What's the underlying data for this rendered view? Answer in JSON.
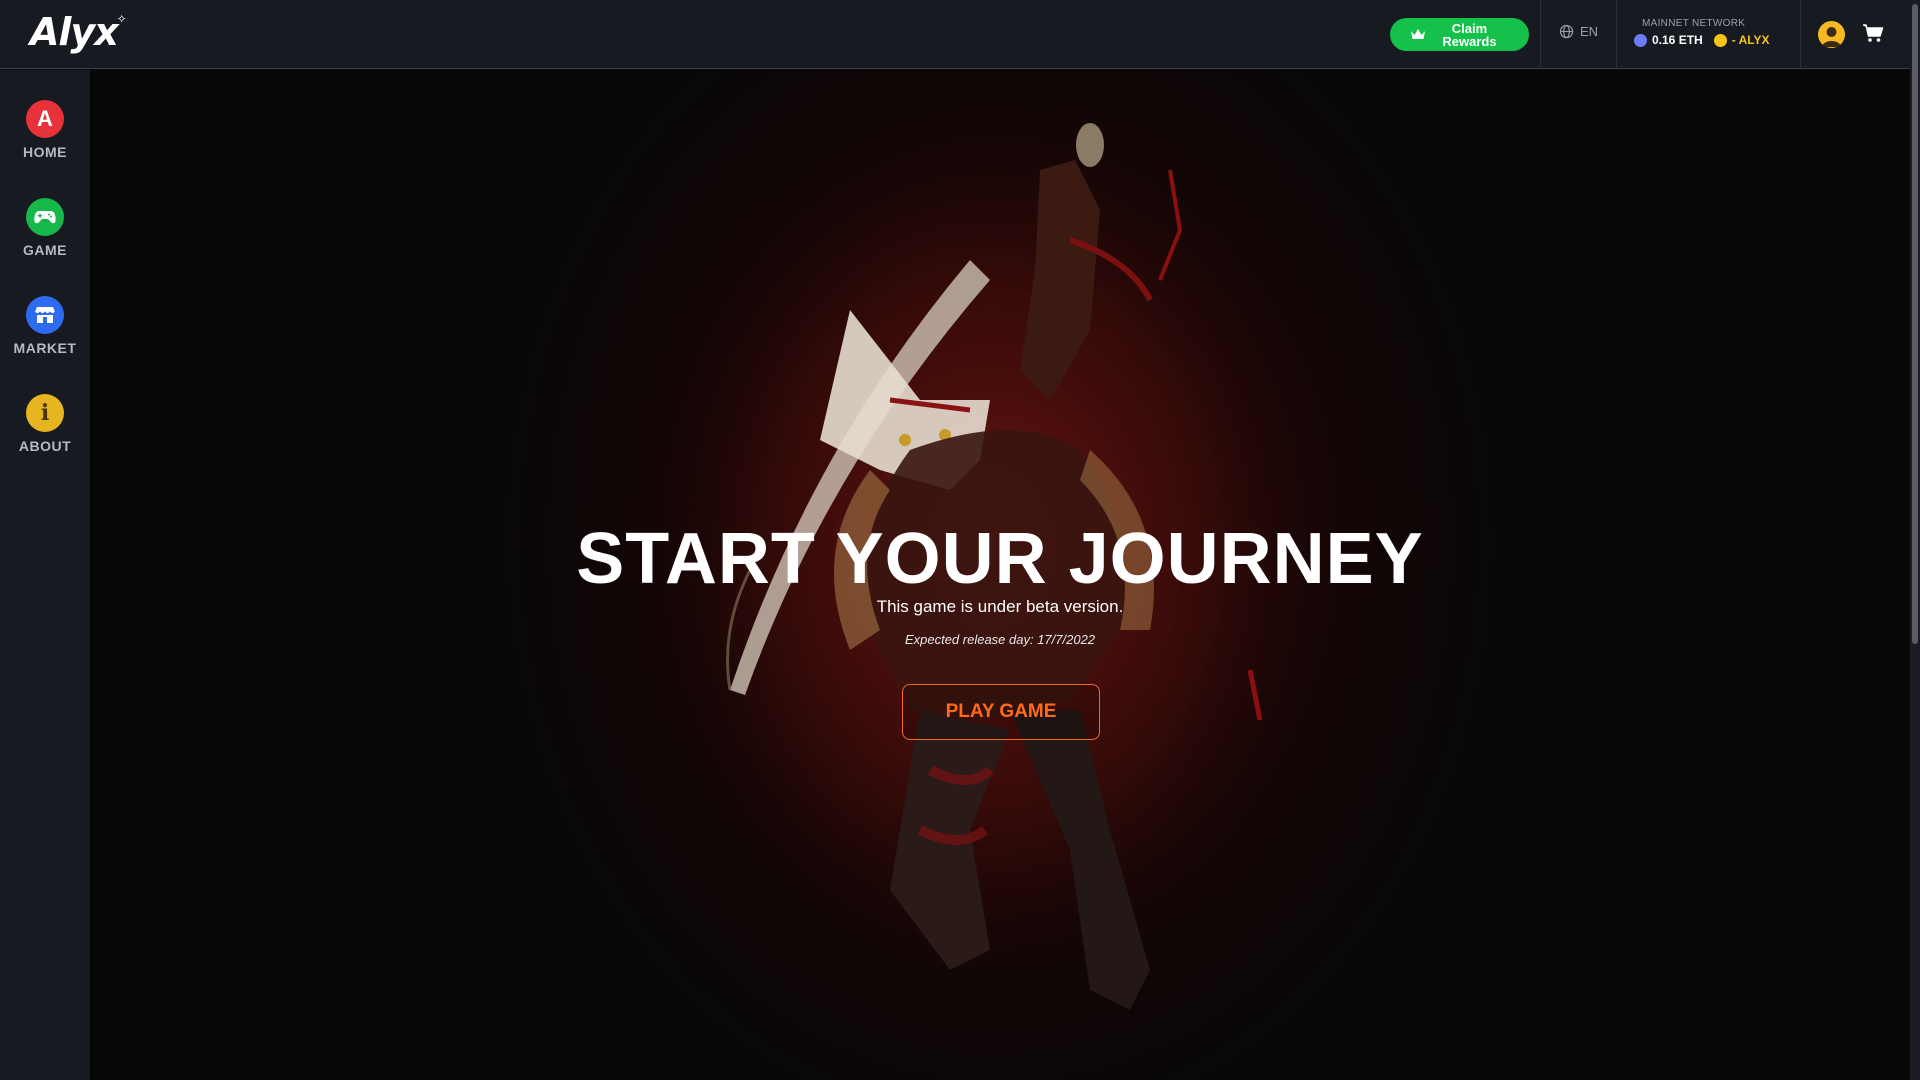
{
  "header": {
    "logo_text": "Alyx",
    "claim_rewards_label": "Claim Rewards",
    "language": "EN",
    "network": {
      "title": "MAINNET NETWORK",
      "eth_balance": "0.16 ETH",
      "alyx_balance": "- ALYX"
    }
  },
  "sidebar": {
    "items": [
      {
        "label": "HOME",
        "icon": "alyx-a-icon",
        "color": "#e8323a"
      },
      {
        "label": "GAME",
        "icon": "gamepad-icon",
        "color": "#16b84a"
      },
      {
        "label": "MARKET",
        "icon": "store-icon",
        "color": "#2f6bf0"
      },
      {
        "label": "ABOUT",
        "icon": "info-icon",
        "color": "#e7b51f"
      }
    ]
  },
  "hero": {
    "title": "START YOUR JOURNEY",
    "subtitle": "This game is under beta version.",
    "release": "Expected release day: 17/7/2022",
    "play_button": "PLAY GAME"
  },
  "colors": {
    "accent_green": "#14c14a",
    "accent_orange": "#ff6a1a",
    "topbar_bg": "#181a21"
  }
}
